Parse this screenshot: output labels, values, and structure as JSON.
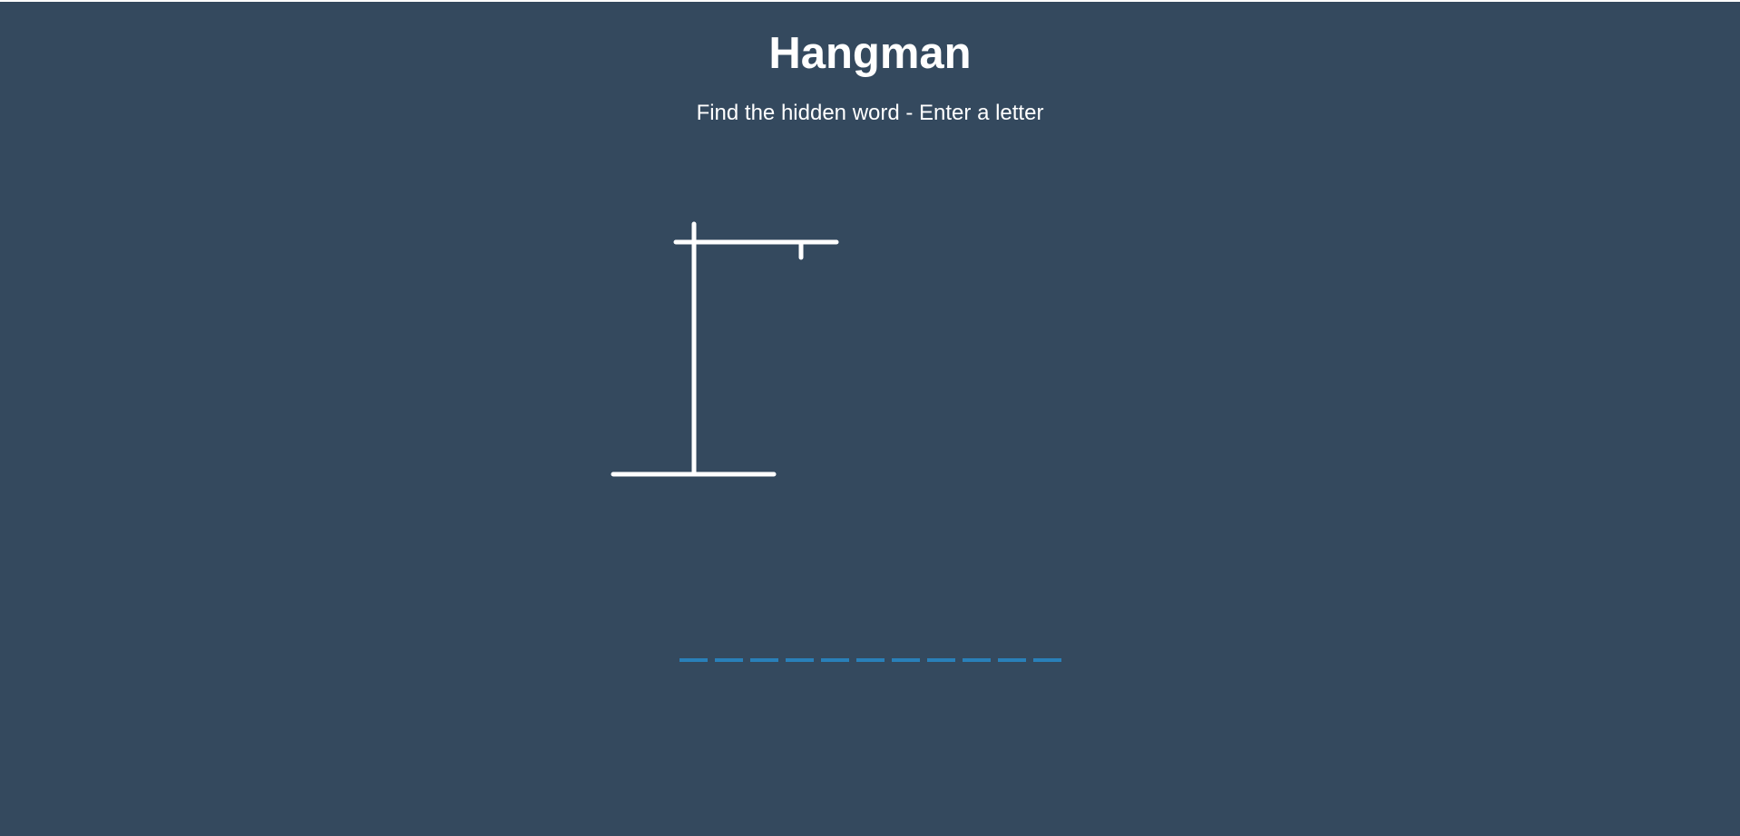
{
  "header": {
    "title": "Hangman",
    "subtitle": "Find the hidden word - Enter a letter"
  },
  "game": {
    "word_slots": [
      "",
      "",
      "",
      "",
      "",
      "",
      "",
      "",
      "",
      "",
      ""
    ],
    "figure_parts_visible": [
      "base",
      "pole",
      "top-beam",
      "rope"
    ]
  },
  "colors": {
    "background": "#34495e",
    "foreground": "#ffffff",
    "slot_underline": "#2980b9"
  }
}
